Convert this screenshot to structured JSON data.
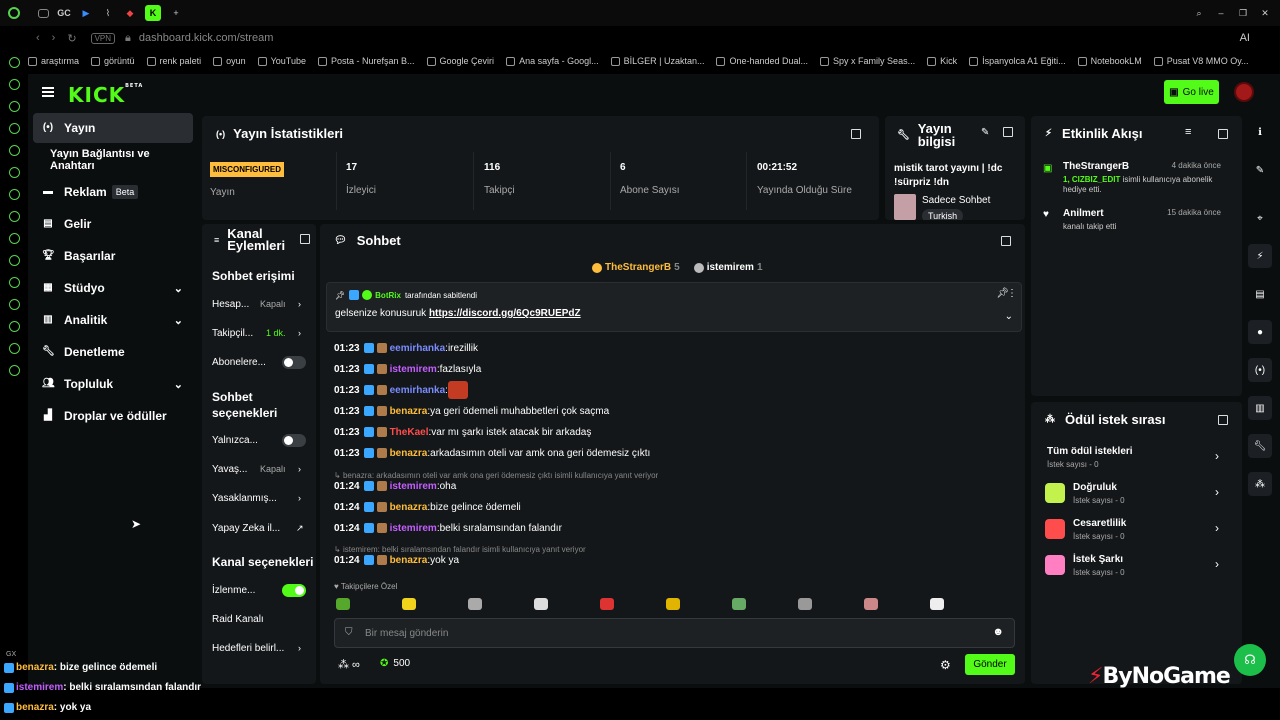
{
  "browser": {
    "tab_labels": [
      "GC"
    ],
    "url": "dashboard.kick.com/stream",
    "vpn": "VPN",
    "ai": "AI",
    "bookmarks": [
      "araştırma",
      "görüntü",
      "renk paleti",
      "oyun",
      "YouTube",
      "Posta - Nurefşan B...",
      "Google Çeviri",
      "Ana sayfa - Googl...",
      "BİLGER | Uzaktan...",
      "One-handed Dual...",
      "Spy x Family Seas...",
      "Kick",
      "İspanyolca A1 Eğiti...",
      "NotebookLM",
      "Pusat V8 MMO Oy..."
    ]
  },
  "header": {
    "logo": "KICK",
    "logo_beta": "BETA",
    "go_live": "Go live"
  },
  "sidebar": {
    "items": [
      {
        "label": "Yayın"
      },
      {
        "label": "Yayın Bağlantısı ve Anahtarı"
      },
      {
        "label": "Reklam",
        "badge": "Beta"
      },
      {
        "label": "Gelir"
      },
      {
        "label": "Başarılar"
      },
      {
        "label": "Stüdyo"
      },
      {
        "label": "Analitik"
      },
      {
        "label": "Denetleme"
      },
      {
        "label": "Topluluk"
      },
      {
        "label": "Droplar ve ödüller"
      }
    ]
  },
  "stats": {
    "title": "Yayın İstatistikleri",
    "status_badge": "MISCONFIGURED",
    "status_label": "Yayın",
    "viewers": "17",
    "viewers_label": "İzleyici",
    "followers": "116",
    "followers_label": "Takipçi",
    "subs": "6",
    "subs_label": "Abone Sayısı",
    "uptime": "00:21:52",
    "uptime_label": "Yayında Olduğu Süre"
  },
  "info": {
    "title": "Yayın bilgisi",
    "stream_title": "mistik tarot yayını | !dc !sürpriz !dn",
    "category": "Sadece Sohbet",
    "language": "Turkish"
  },
  "activity": {
    "title": "Etkinlik Akışı",
    "events": [
      {
        "name": "TheStrangerB",
        "ago": "4 dakika önce",
        "highlight": "1, CIZBIZ_EDIT",
        "text": "isimli kullanıcıya abonelik hediye etti."
      },
      {
        "name": "Anilmert",
        "ago": "15 dakika önce",
        "text": "kanalı takip etti"
      }
    ]
  },
  "actions": {
    "title": "Kanal Eylemleri",
    "chat_access": "Sohbet erişimi",
    "rows1": [
      {
        "label": "Hesap...",
        "value": "Kapalı"
      },
      {
        "label": "Takipçil...",
        "value": "1 dk."
      },
      {
        "label": "Abonelere..."
      }
    ],
    "chat_options": "Sohbet seçenekleri",
    "rows2": [
      {
        "label": "Yalnızca..."
      },
      {
        "label": "Yavaş...",
        "value": "Kapalı"
      },
      {
        "label": "Yasaklanmış..."
      },
      {
        "label": "Yapay Zeka il..."
      }
    ],
    "channel_options": "Kanal seçenekleri",
    "rows3": [
      {
        "label": "İzlenme..."
      },
      {
        "label": "Raid Kanalı"
      },
      {
        "label": "Hedefleri belirl..."
      }
    ]
  },
  "chat": {
    "title": "Sohbet",
    "top_gifters": [
      {
        "name": "TheStrangerB",
        "count": "5"
      },
      {
        "name": "istemirem",
        "count": "1"
      }
    ],
    "pinned_by": "BotRix",
    "pinned_suffix": "tarafından sabitlendi",
    "pinned_text": "gelsenize konusuruk",
    "pinned_link": "https://discord.gg/6Qc9RUEPdZ",
    "messages": [
      {
        "time": "01:23",
        "user": "eemirhanka",
        "color": "#7a8bff",
        "text": "irezillik"
      },
      {
        "time": "01:23",
        "user": "istemirem",
        "color": "#c45eff",
        "text": "fazlasıyla"
      },
      {
        "time": "01:23",
        "user": "eemirhanka",
        "color": "#7a8bff",
        "text": ""
      },
      {
        "time": "01:23",
        "user": "benazra",
        "color": "#ffbd3d",
        "text": "ya geri ödemeli muhabbetleri çok saçma"
      },
      {
        "time": "01:23",
        "user": "TheKael",
        "color": "#ff4d4d",
        "text": "var mı şarkı istek atacak bir arkadaş"
      },
      {
        "time": "01:23",
        "user": "benazra",
        "color": "#ffbd3d",
        "text": "arkadasımın oteli var amk ona geri ödemesiz çıktı"
      },
      {
        "time": "01:24",
        "user": "istemirem",
        "color": "#c45eff",
        "text": "oha"
      },
      {
        "time": "01:24",
        "user": "benazra",
        "color": "#ffbd3d",
        "text": "bize gelince ödemeli"
      },
      {
        "time": "01:24",
        "user": "istemirem",
        "color": "#c45eff",
        "text": "belki sıralamsından falandır"
      },
      {
        "time": "01:24",
        "user": "benazra",
        "color": "#ffbd3d",
        "text": "yok ya"
      }
    ],
    "reply1": "benazra: arkadasımın oteli var amk ona geri ödemesiz çıktı isimli kullanıcıya yanıt veriyor",
    "reply2": "istemirem: belki sıralamsından falandır isimli kullanıcıya yanıt veriyor",
    "emote_tab": "Takipçilere Özel",
    "input_placeholder": "Bir mesaj gönderin",
    "points": "500",
    "send": "Gönder"
  },
  "rewards": {
    "title": "Ödül istek sırası",
    "all_label": "Tüm ödül istekleri",
    "all_count": "İstek sayısı - 0",
    "items": [
      {
        "label": "Doğruluk",
        "count": "İstek sayısı - 0",
        "color": "#c2f24b"
      },
      {
        "label": "Cesaretlilik",
        "count": "İstek sayısı - 0",
        "color": "#ff4d4d"
      },
      {
        "label": "İstek Şarkı",
        "count": "İstek sayısı - 0",
        "color": "#ff7fc2"
      }
    ]
  },
  "overlay": {
    "gx": "GX",
    "lines": [
      {
        "user": "benazra",
        "color": "#ffbd3d",
        "text": ": bize gelince ödemeli"
      },
      {
        "user": "istemirem",
        "color": "#c45eff",
        "text": ": belki sıralamsından falandır"
      },
      {
        "user": "benazra",
        "color": "#ffbd3d",
        "text": ": yok ya"
      }
    ],
    "watermark": "ByNoGame"
  }
}
